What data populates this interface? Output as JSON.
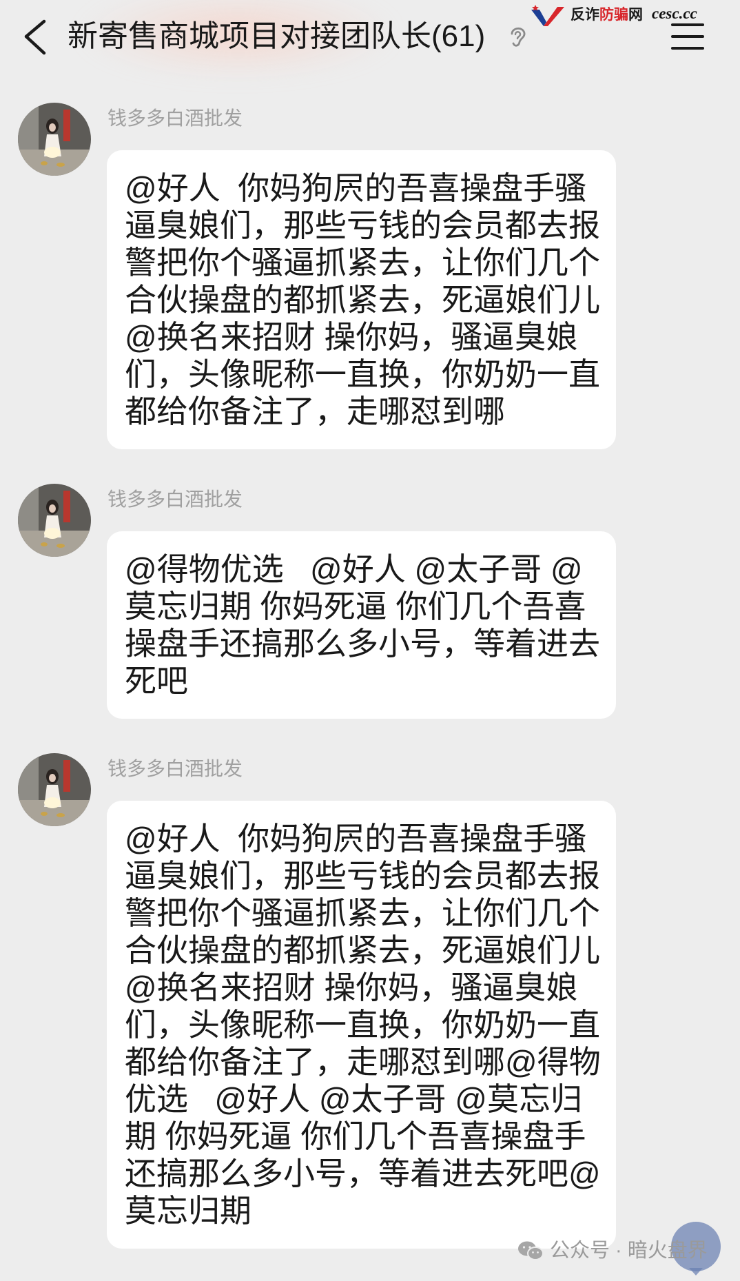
{
  "header": {
    "title": "新寄售商城项目对接团队长(61)",
    "back_icon": "back-arrow-icon",
    "status_icon": "ear-icon",
    "menu_icon": "menu-icon"
  },
  "watermark_top": {
    "site_part_1": "反诈",
    "site_part_2": "防骗",
    "site_part_3": "网",
    "domain": "cesc.cc",
    "logo_icon": "v-logo-icon"
  },
  "messages": [
    {
      "sender": "钱多多白酒批发",
      "text": "@好人  你妈狗屄的吾喜操盘手骚\n逼臭娘们，那些亏钱的会员都去报\n警把你个骚逼抓紧去，让你们几个\n合伙操盘的都抓紧去，死逼娘们儿\n@换名来招财 操你妈，骚逼臭娘\n们，头像昵称一直换，你奶奶一直\n都给你备注了，走哪怼到哪"
    },
    {
      "sender": "钱多多白酒批发",
      "text": "@得物优选   @好人 @太子哥 @\n莫忘归期 你妈死逼 你们几个吾喜\n操盘手还搞那么多小号，等着进去\n死吧"
    },
    {
      "sender": "钱多多白酒批发",
      "text": "@好人  你妈狗屄的吾喜操盘手骚\n逼臭娘们，那些亏钱的会员都去报\n警把你个骚逼抓紧去，让你们几个\n合伙操盘的都抓紧去，死逼娘们儿\n@换名来招财 操你妈，骚逼臭娘\n们，头像昵称一直换，你奶奶一直\n都给你备注了，走哪怼到哪@得物\n优选   @好人 @太子哥 @莫忘归\n期 你妈死逼 你们几个吾喜操盘手\n还搞那么多小号，等着进去死吧@\n莫忘归期"
    }
  ],
  "watermark_bottom": {
    "text": "公众号 · 暗火盘界",
    "icon": "wechat-icon"
  },
  "colors": {
    "page_bg": "#ededed",
    "bubble_bg": "#ffffff",
    "message_text": "#191919",
    "sender_name": "#a0a0a0",
    "watermark_red": "#d8262b",
    "watermark_blue": "#1c3f95"
  }
}
